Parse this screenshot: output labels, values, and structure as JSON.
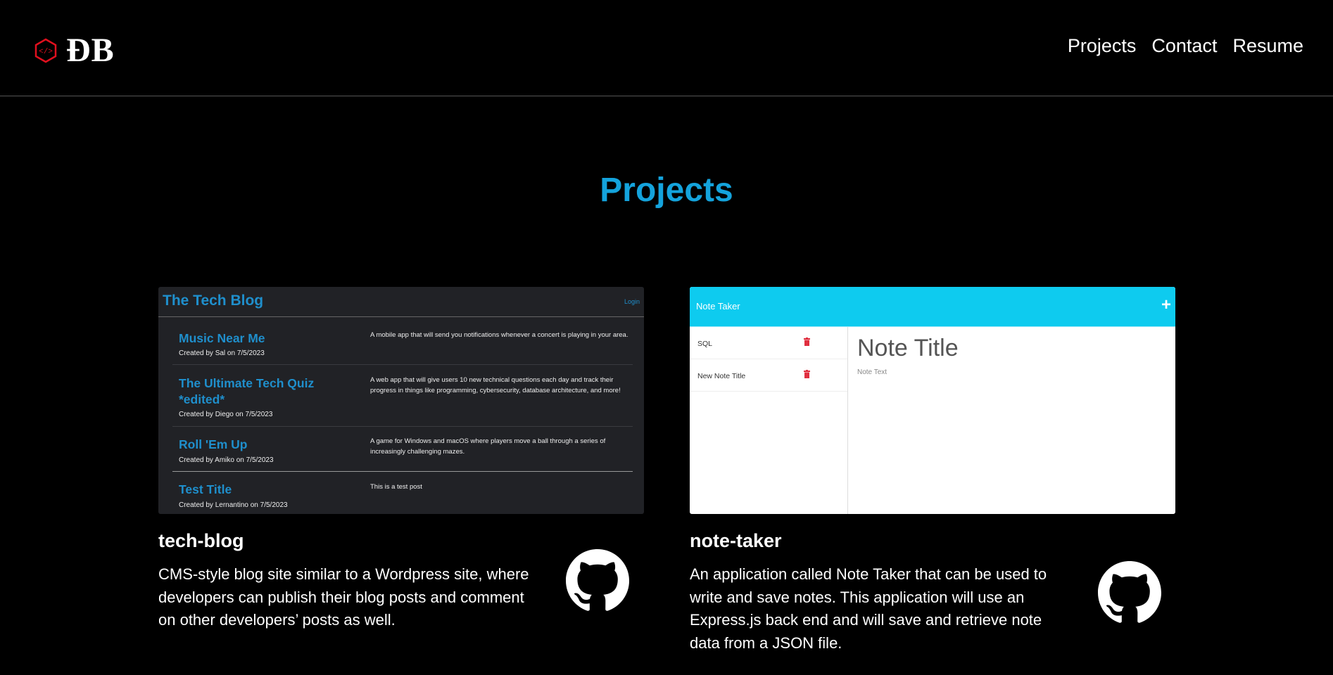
{
  "header": {
    "logo_text": "ĐB",
    "nav": [
      "Projects",
      "Contact",
      "Resume"
    ]
  },
  "page_title": "Projects",
  "colors": {
    "accent": "#14a3dc",
    "logo_red": "#e0101e",
    "note_header": "#0ecbef"
  },
  "projects": [
    {
      "name": "tech-blog",
      "description": "CMS-style blog site similar to a Wordpress site, where developers can publish their blog posts and comment on other developers’ posts as well.",
      "icon": "github-icon",
      "screenshot": {
        "title": "The Tech Blog",
        "login": "Login",
        "posts": [
          {
            "title": "Music Near Me",
            "meta": "Created by Sal on 7/5/2023",
            "desc": "A mobile app that will send you notifications whenever a concert is playing in your area."
          },
          {
            "title": "The Ultimate Tech Quiz *edited*",
            "meta": "Created by Diego on 7/5/2023",
            "desc": "A web app that will give users 10 new technical questions each day and track their progress in things like programming, cybersecurity, database architecture, and more!"
          },
          {
            "title": "Roll 'Em Up",
            "meta": "Created by Amiko on 7/5/2023",
            "desc": "A game for Windows and macOS where players move a ball through a series of increasingly challenging mazes."
          },
          {
            "title": "Test Title",
            "meta": "Created by Lernantino on 7/5/2023",
            "desc": "This is a test post"
          }
        ]
      }
    },
    {
      "name": "note-taker",
      "description": "An application called Note Taker that can be used to write and save notes. This application will use an Express.js back end and will save and retrieve note data from a JSON file.",
      "icon": "github-icon",
      "screenshot": {
        "title": "Note Taker",
        "plus": "+",
        "notes": [
          "SQL",
          "New Note Title"
        ],
        "note_title_placeholder": "Note Title",
        "note_text_placeholder": "Note Text"
      }
    }
  ]
}
